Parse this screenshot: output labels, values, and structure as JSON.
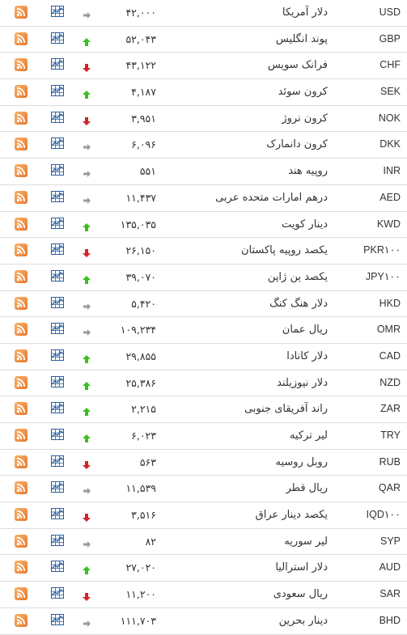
{
  "colors": {
    "up": "#3bbf1f",
    "down": "#d2232a",
    "same": "#9a9a9a",
    "rss": "#ee8b3e",
    "chart": "#2a5f9e"
  },
  "rates": [
    {
      "code": "USD",
      "name": "دلار آمریکا",
      "value": "۴۲,۰۰۰",
      "trend": "same"
    },
    {
      "code": "GBP",
      "name": "پوند انگلیس",
      "value": "۵۲,۰۴۳",
      "trend": "up"
    },
    {
      "code": "CHF",
      "name": "فرانک سویس",
      "value": "۴۳,۱۲۲",
      "trend": "down"
    },
    {
      "code": "SEK",
      "name": "کرون سوئد",
      "value": "۴,۱۸۷",
      "trend": "up"
    },
    {
      "code": "NOK",
      "name": "کرون نروژ",
      "value": "۳,۹۵۱",
      "trend": "down"
    },
    {
      "code": "DKK",
      "name": "کرون دانمارک",
      "value": "۶,۰۹۶",
      "trend": "same"
    },
    {
      "code": "INR",
      "name": "روپیه هند",
      "value": "۵۵۱",
      "trend": "same"
    },
    {
      "code": "AED",
      "name": "درهم امارات متحده عربی",
      "value": "۱۱,۴۳۷",
      "trend": "same"
    },
    {
      "code": "KWD",
      "name": "دینار کویت",
      "value": "۱۳۵,۰۳۵",
      "trend": "up"
    },
    {
      "code": "PKR۱۰۰",
      "name": "یکصد روپیه پاکستان",
      "value": "۲۶,۱۵۰",
      "trend": "down"
    },
    {
      "code": "JPY۱۰۰",
      "name": "یکصد ین ژاپن",
      "value": "۳۹,۰۷۰",
      "trend": "up"
    },
    {
      "code": "HKD",
      "name": "دلار هنگ کنگ",
      "value": "۵,۴۲۰",
      "trend": "same"
    },
    {
      "code": "OMR",
      "name": "ریال عمان",
      "value": "۱۰۹,۲۳۴",
      "trend": "same"
    },
    {
      "code": "CAD",
      "name": "دلار کانادا",
      "value": "۲۹,۸۵۵",
      "trend": "up"
    },
    {
      "code": "NZD",
      "name": "دلار نیوزیلند",
      "value": "۲۵,۳۸۶",
      "trend": "up"
    },
    {
      "code": "ZAR",
      "name": "راند آفریقای جنوبی",
      "value": "۲,۲۱۵",
      "trend": "up"
    },
    {
      "code": "TRY",
      "name": "لیر ترکیه",
      "value": "۶,۰۲۳",
      "trend": "up"
    },
    {
      "code": "RUB",
      "name": "روبل روسیه",
      "value": "۵۶۳",
      "trend": "down"
    },
    {
      "code": "QAR",
      "name": "ریال قطر",
      "value": "۱۱,۵۳۹",
      "trend": "same"
    },
    {
      "code": "IQD۱۰۰",
      "name": "یکصد دینار عراق",
      "value": "۳,۵۱۶",
      "trend": "down"
    },
    {
      "code": "SYP",
      "name": "لیر سوریه",
      "value": "۸۲",
      "trend": "same"
    },
    {
      "code": "AUD",
      "name": "دلار استرالیا",
      "value": "۲۷,۰۲۰",
      "trend": "up"
    },
    {
      "code": "SAR",
      "name": "ریال سعودی",
      "value": "۱۱,۲۰۰",
      "trend": "down"
    },
    {
      "code": "BHD",
      "name": "دینار بحرین",
      "value": "۱۱۱,۷۰۳",
      "trend": "same"
    }
  ]
}
